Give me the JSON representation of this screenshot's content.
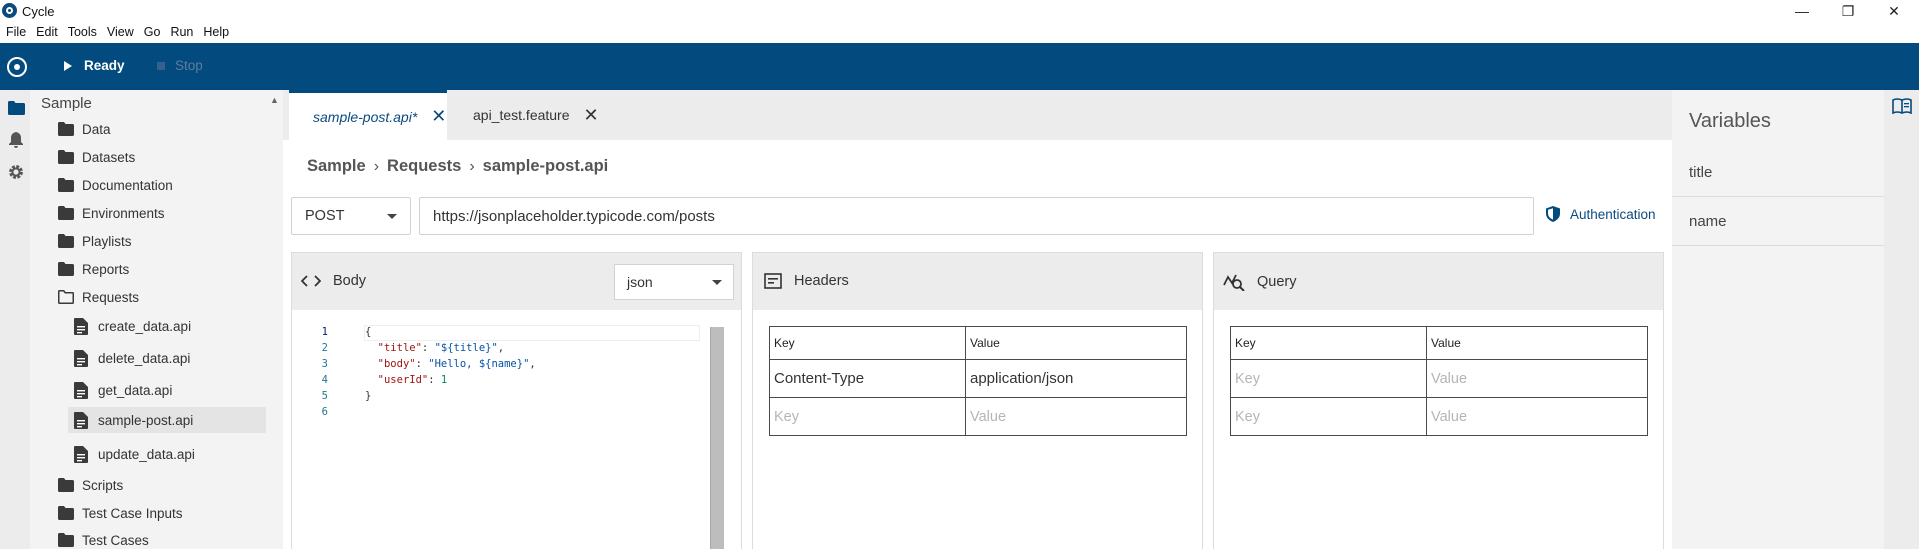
{
  "window": {
    "title": "Cycle",
    "controls": {
      "minimize": "—",
      "restore": "❐",
      "close": "✕"
    }
  },
  "menu": [
    "File",
    "Edit",
    "Tools",
    "View",
    "Go",
    "Run",
    "Help"
  ],
  "toolbar": {
    "status_label": "Ready",
    "stop_label": "Stop"
  },
  "rail_icons": [
    "folder-icon",
    "bell-icon",
    "gear-icon"
  ],
  "explorer": {
    "root": "Sample",
    "items": [
      {
        "label": "Data",
        "type": "folder"
      },
      {
        "label": "Datasets",
        "type": "folder"
      },
      {
        "label": "Documentation",
        "type": "folder"
      },
      {
        "label": "Environments",
        "type": "folder"
      },
      {
        "label": "Playlists",
        "type": "folder"
      },
      {
        "label": "Reports",
        "type": "folder"
      },
      {
        "label": "Requests",
        "type": "folder-open"
      },
      {
        "label": "create_data.api",
        "type": "file"
      },
      {
        "label": "delete_data.api",
        "type": "file"
      },
      {
        "label": "get_data.api",
        "type": "file"
      },
      {
        "label": "sample-post.api",
        "type": "file",
        "selected": true
      },
      {
        "label": "update_data.api",
        "type": "file"
      },
      {
        "label": "Scripts",
        "type": "folder"
      },
      {
        "label": "Test Case Inputs",
        "type": "folder"
      },
      {
        "label": "Test Cases",
        "type": "folder"
      }
    ]
  },
  "tabs": [
    {
      "label": "sample-post.api*",
      "active": true,
      "close": "✕"
    },
    {
      "label": "api_test.feature",
      "active": false,
      "close": "✕"
    }
  ],
  "breadcrumb": [
    "Sample",
    "Requests",
    "sample-post.api"
  ],
  "request": {
    "method": "POST",
    "url": "https://jsonplaceholder.typicode.com/posts",
    "auth_label": "Authentication"
  },
  "body_panel": {
    "title": "Body",
    "format": "json",
    "line_numbers": [
      "1",
      "2",
      "3",
      "4",
      "5",
      "6"
    ],
    "lines": [
      {
        "text": "{"
      },
      {
        "indent": "  ",
        "key": "\"title\"",
        "colon": ": ",
        "value": "\"${title}\"",
        "trail": ","
      },
      {
        "indent": "  ",
        "key": "\"body\"",
        "colon": ": ",
        "value": "\"Hello, ${name}\"",
        "trail": ","
      },
      {
        "indent": "  ",
        "key": "\"userId\"",
        "colon": ": ",
        "num": "1",
        "trail": ""
      },
      {
        "text": "}"
      },
      {
        "text": ""
      }
    ]
  },
  "headers_panel": {
    "title": "Headers",
    "columns": [
      "Key",
      "Value"
    ],
    "rows": [
      [
        "Content-Type",
        "application/json"
      ]
    ],
    "placeholder_row": [
      "Key",
      "Value"
    ]
  },
  "query_panel": {
    "title": "Query",
    "columns": [
      "Key",
      "Value"
    ],
    "placeholder_rows": [
      [
        "Key",
        "Value"
      ],
      [
        "Key",
        "Value"
      ]
    ]
  },
  "variables": {
    "title": "Variables",
    "items": [
      "title",
      "name"
    ]
  },
  "colors": {
    "accent": "#034a7e",
    "panel_bg": "#ececec",
    "sidebar_bg": "#f3f3f3"
  }
}
